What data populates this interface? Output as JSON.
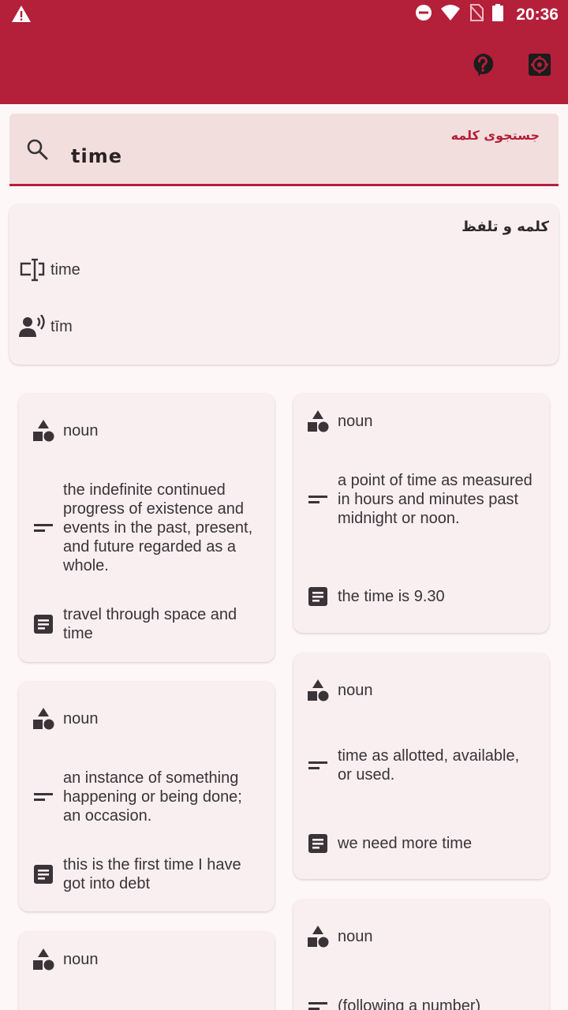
{
  "status_bar": {
    "time": "20:36",
    "icons": [
      "warning-icon",
      "do-not-disturb-icon",
      "wifi-icon",
      "no-sim-icon",
      "battery-icon"
    ]
  },
  "app_bar": {
    "actions": [
      "help-icon",
      "settings-icon"
    ]
  },
  "colors": {
    "primary": "#b41f3a",
    "surface": "#f9eff1",
    "search_background": "#f2dedd"
  },
  "search": {
    "label": "جستجوی کلمه",
    "value": "time"
  },
  "word_card": {
    "title": "کلمه و تلفظ",
    "word": "time",
    "pronunciation": "tīm"
  },
  "definitions": [
    {
      "part_of_speech": "noun",
      "definition": "the indefinite continued progress of existence and events in the past, present, and future regarded as a whole.",
      "example": "travel through space and time"
    },
    {
      "part_of_speech": "noun",
      "definition": "a point of time as measured in hours and minutes past midnight or noon.",
      "example": "the time is 9.30"
    },
    {
      "part_of_speech": "noun",
      "definition": "an instance of something happening or being done; an occasion.",
      "example": "this is the first time I have got into debt"
    },
    {
      "part_of_speech": "noun",
      "definition": "time as allotted, available, or used.",
      "example": "we need more time"
    },
    {
      "part_of_speech": "noun",
      "definition": "",
      "example": ""
    },
    {
      "part_of_speech": "noun",
      "definition": "(following a number)",
      "example": ""
    }
  ]
}
